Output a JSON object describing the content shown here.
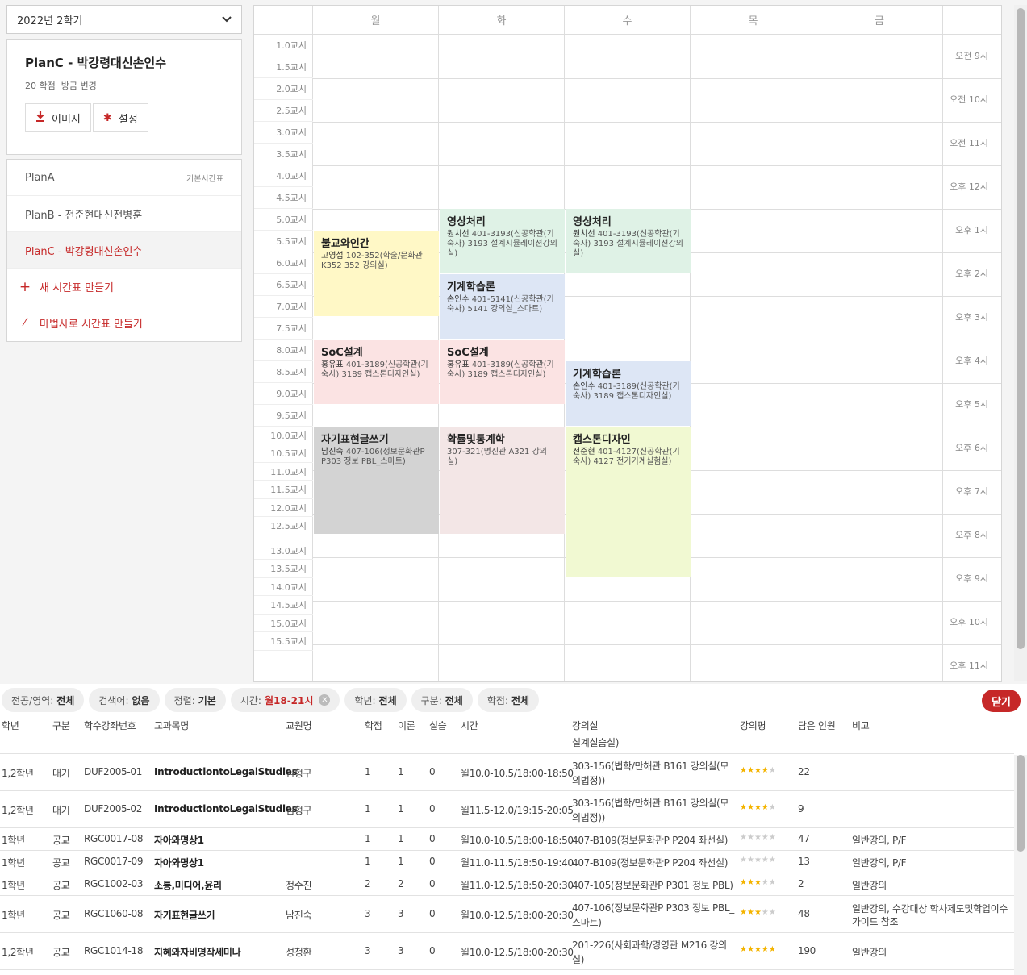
{
  "semester": {
    "selected": "2022년 2학기"
  },
  "plan_card": {
    "title": "PlanC - 박강령대신손인수",
    "credits": "20 학점",
    "changed": "방금 변경",
    "image_btn": "이미지",
    "settings_btn": "설정"
  },
  "plans": [
    {
      "label": "PlanA",
      "tag": "기본시간표"
    },
    {
      "label": "PlanB - 전준현대신전병훈",
      "tag": ""
    },
    {
      "label": "PlanC - 박강령대신손인수",
      "tag": ""
    }
  ],
  "actions": {
    "new_timetable": "새 시간표 만들기",
    "wizard": "마법사로 시간표 만들기"
  },
  "days": [
    "월",
    "화",
    "수",
    "목",
    "금"
  ],
  "periods": [
    "1.0교시",
    "1.5교시",
    "2.0교시",
    "2.5교시",
    "3.0교시",
    "3.5교시",
    "4.0교시",
    "4.5교시",
    "5.0교시",
    "5.5교시",
    "6.0교시",
    "6.5교시",
    "7.0교시",
    "7.5교시",
    "8.0교시",
    "8.5교시",
    "9.0교시",
    "9.5교시",
    "10.0교시",
    "10.5교시",
    "11.0교시",
    "11.5교시",
    "12.0교시",
    "12.5교시",
    "13.0교시",
    "13.5교시",
    "14.0교시",
    "14.5교시",
    "15.0교시",
    "15.5교시"
  ],
  "hours": [
    "오전 9시",
    "오전 10시",
    "오전 11시",
    "오후 12시",
    "오후 1시",
    "오후 2시",
    "오후 3시",
    "오후 4시",
    "오후 5시",
    "오후 6시",
    "오후 7시",
    "오후 8시",
    "오후 9시",
    "오후 10시",
    "오후 11시"
  ],
  "courses": [
    {
      "name": "불교와인간",
      "prof": "고영섭",
      "room": "102-352(학술/문화관 K352 352 강의실)",
      "color": "#fff8c6"
    },
    {
      "name": "영상처리",
      "prof": "원치선",
      "room": "401-3193(신공학관(기숙사) 3193 설계시뮬레이션강의실)",
      "color": "#dff2e6"
    },
    {
      "name": "기계학습론",
      "prof": "손인수",
      "room": "401-5141(신공학관(기숙사) 5141 강의실_스마트)",
      "color": "#dde6f5"
    },
    {
      "name": "SoC설계",
      "prof": "홍유표",
      "room": "401-3189(신공학관(기숙사) 3189 캡스톤디자인실)",
      "color": "#fbe3e3"
    },
    {
      "name": "영상처리",
      "prof": "원치선",
      "room": "401-3193(신공학관(기숙사) 3193 설계시뮬레이션강의실)",
      "color": "#dff2e6"
    },
    {
      "name": "SoC설계",
      "prof": "홍유표",
      "room": "401-3189(신공학관(기숙사) 3189 캡스톤디자인실)",
      "color": "#fbe3e3"
    },
    {
      "name": "기계학습론",
      "prof": "손인수",
      "room": "401-3189(신공학관(기숙사) 3189 캡스톤디자인실)",
      "color": "#dde6f5"
    },
    {
      "name": "자기표현글쓰기",
      "prof": "남진숙",
      "room": "407-106(정보문화관P P303 정보 PBL_스마트)",
      "color": "#d3d3d3"
    },
    {
      "name": "확률및통계학",
      "prof": "",
      "room": " 307-321(명진관 A321 강의실)",
      "color": "#f3e6e6"
    },
    {
      "name": "캡스톤디자인",
      "prof": "전준현",
      "room": "401-4127(신공학관(기숙사) 4127 전기기계실험실)",
      "color": "#f1f9d2"
    }
  ],
  "filters": [
    {
      "key": "전공/영역:",
      "val": "전체"
    },
    {
      "key": "검색어:",
      "val": "없음"
    },
    {
      "key": "정렬:",
      "val": "기본"
    },
    {
      "key": "시간:",
      "val": "월18-21시"
    },
    {
      "key": "학년:",
      "val": "전체"
    },
    {
      "key": "구분:",
      "val": "전체"
    },
    {
      "key": "학점:",
      "val": "전체"
    }
  ],
  "close_label": "닫기",
  "table": {
    "headers": [
      "학년",
      "구분",
      "학수강좌번호",
      "교과목명",
      "교원명",
      "학점",
      "이론",
      "실습",
      "시간",
      "강의실",
      "강의평",
      "담은 인원",
      "비고"
    ],
    "partial_row": {
      "room": "설계실습실)"
    },
    "rows": [
      {
        "year": "1,2학년",
        "type": "대기",
        "code": "DUF2005-01",
        "name": "IntroductiontoLegalStudies",
        "prof": "김형구",
        "credit": "1",
        "theory": "1",
        "lab": "0",
        "time": "월10.0-10.5/18:00-18:50",
        "room1": "303-156(법학/만해관 B161 강의실(모",
        "room2": "의법정))",
        "rating": 4,
        "count": "22",
        "note1": "",
        "note2": ""
      },
      {
        "year": "1,2학년",
        "type": "대기",
        "code": "DUF2005-02",
        "name": "IntroductiontoLegalStudies",
        "prof": "김형구",
        "credit": "1",
        "theory": "1",
        "lab": "0",
        "time": "월11.5-12.0/19:15-20:05",
        "room1": "303-156(법학/만해관 B161 강의실(모",
        "room2": "의법정))",
        "rating": 4,
        "count": "9",
        "note1": "",
        "note2": ""
      },
      {
        "year": "1학년",
        "type": "공교",
        "code": "RGC0017-08",
        "name": "자아와명상1",
        "prof": "",
        "credit": "1",
        "theory": "1",
        "lab": "0",
        "time": "월10.0-10.5/18:00-18:50",
        "room1": "407-B109(정보문화관P P204 좌선실)",
        "room2": "",
        "rating": 0,
        "count": "47",
        "note1": "일반강의, P/F",
        "note2": ""
      },
      {
        "year": "1학년",
        "type": "공교",
        "code": "RGC0017-09",
        "name": "자아와명상1",
        "prof": "",
        "credit": "1",
        "theory": "1",
        "lab": "0",
        "time": "월11.0-11.5/18:50-19:40",
        "room1": "407-B109(정보문화관P P204 좌선실)",
        "room2": "",
        "rating": 0,
        "count": "13",
        "note1": "일반강의, P/F",
        "note2": ""
      },
      {
        "year": "1학년",
        "type": "공교",
        "code": "RGC1002-03",
        "name": "소통,미디어,윤리",
        "prof": "정수진",
        "credit": "2",
        "theory": "2",
        "lab": "0",
        "time": "월11.0-12.5/18:50-20:30",
        "room1": "407-105(정보문화관P P301 정보 PBL)",
        "room2": "",
        "rating": 3,
        "count": "2",
        "note1": "일반강의",
        "note2": ""
      },
      {
        "year": "1학년",
        "type": "공교",
        "code": "RGC1060-08",
        "name": "자기표현글쓰기",
        "prof": "남진숙",
        "credit": "3",
        "theory": "3",
        "lab": "0",
        "time": "월10.0-12.5/18:00-20:30",
        "room1": "407-106(정보문화관P P303 정보 PBL_",
        "room2": "스마트)",
        "rating": 3,
        "count": "48",
        "note1": "일반강의, 수강대상 학사제도및학업이수",
        "note2": "가이드 참조"
      },
      {
        "year": "1,2학년",
        "type": "공교",
        "code": "RGC1014-18",
        "name": "지혜와자비명작세미나",
        "prof": "성청환",
        "credit": "3",
        "theory": "3",
        "lab": "0",
        "time": "월10.0-12.5/18:00-20:30",
        "room1": "201-226(사회과학/경영관 M216 강의",
        "room2": "실)",
        "rating": 5,
        "count": "190",
        "note1": "일반강의",
        "note2": ""
      }
    ]
  }
}
